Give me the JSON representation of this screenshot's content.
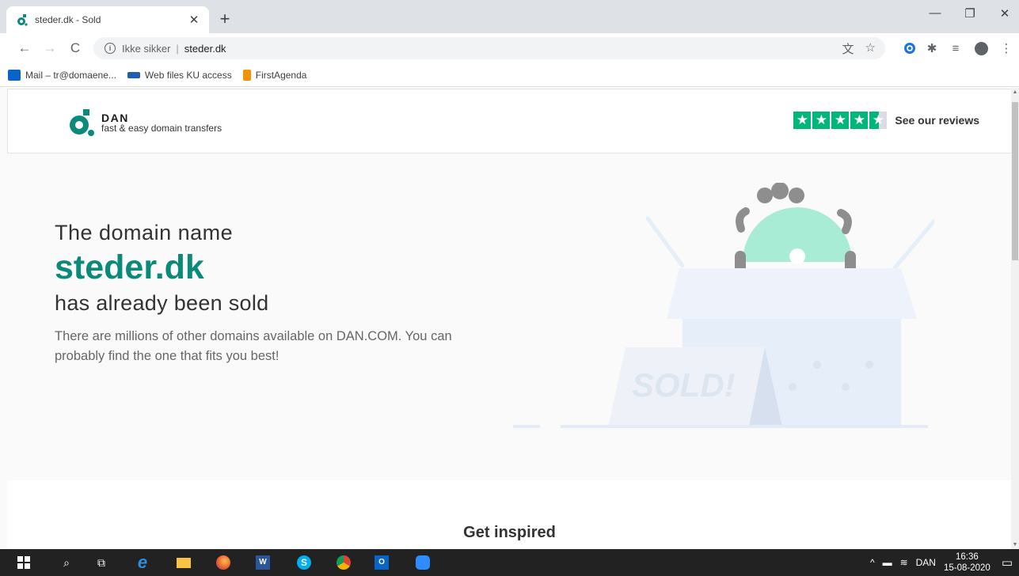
{
  "browser": {
    "tab_title": "steder.dk - Sold",
    "tab_close": "✕",
    "new_tab": "+",
    "security_label": "Ikke sikker",
    "url": "steder.dk",
    "bookmarks": [
      {
        "label": "Mail – tr@domaene...",
        "icon": "outlook-icon",
        "color": "#0a64c8"
      },
      {
        "label": "Web files KU access",
        "icon": "ku-icon",
        "color": "#1e5fb4"
      },
      {
        "label": "FirstAgenda",
        "icon": "firstagenda-icon",
        "color": "#f39200"
      }
    ]
  },
  "site": {
    "logo_name": "DAN",
    "logo_tagline": "fast & easy domain transfers",
    "reviews_label": "See our reviews",
    "trustpilot_stars": 4.5,
    "hero_pre": "The domain name",
    "hero_domain": "steder.dk",
    "hero_post": "has already been sold",
    "hero_desc": "There are millions of other domains available on DAN.COM. You can probably find the one that fits you best!",
    "sold_sign": "SOLD!",
    "inspired_heading": "Get inspired",
    "accent_color": "#0b8a7a",
    "illustration_color": "#a8ecd6"
  },
  "taskbar": {
    "language": "DAN",
    "time": "16:36",
    "date": "15-08-2020"
  }
}
